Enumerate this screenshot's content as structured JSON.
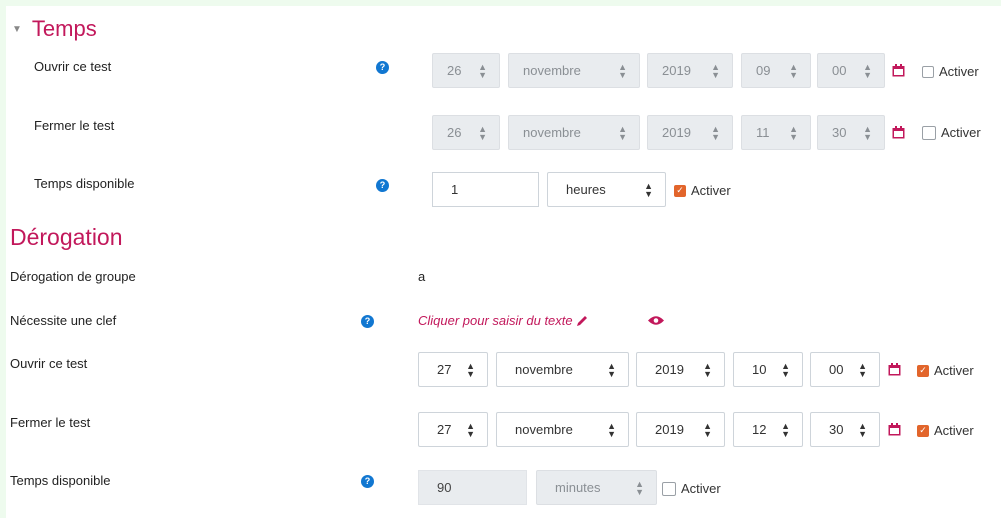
{
  "temps": {
    "heading": "Temps",
    "toggle_icon": "caret-down-icon",
    "rows": [
      {
        "label": "Ouvrir ce test",
        "help": true,
        "day": "26",
        "month": "novembre",
        "year": "2019",
        "hour": "09",
        "minute": "00",
        "activer_label": "Activer",
        "activer_checked": false
      },
      {
        "label": "Fermer le test",
        "help": false,
        "day": "26",
        "month": "novembre",
        "year": "2019",
        "hour": "11",
        "minute": "30",
        "activer_label": "Activer",
        "activer_checked": false
      }
    ],
    "duration": {
      "label": "Temps disponible",
      "value": "1",
      "unit": "heures",
      "activer_label": "Activer",
      "activer_checked": true
    }
  },
  "derogation": {
    "heading": "Dérogation",
    "group_label": "Dérogation de groupe",
    "group_value": "a",
    "key_label": "Nécessite une clef",
    "key_link": "Cliquer pour saisir du texte",
    "rows": [
      {
        "label": "Ouvrir ce test",
        "day": "27",
        "month": "novembre",
        "year": "2019",
        "hour": "10",
        "minute": "00",
        "activer_label": "Activer",
        "activer_checked": true
      },
      {
        "label": "Fermer le test",
        "day": "27",
        "month": "novembre",
        "year": "2019",
        "hour": "12",
        "minute": "30",
        "activer_label": "Activer",
        "activer_checked": true
      }
    ],
    "duration": {
      "label": "Temps disponible",
      "value": "90",
      "unit": "minutes",
      "activer_label": "Activer",
      "activer_checked": false
    }
  },
  "colors": {
    "accent": "#c2185b",
    "help": "#1177d1",
    "check": "#e2652b"
  }
}
